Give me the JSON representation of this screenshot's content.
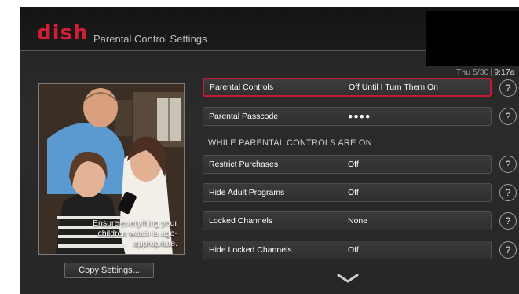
{
  "header": {
    "brand": "dish",
    "title": "Parental Control Settings"
  },
  "status": {
    "date": "Thu 5/30",
    "separator": "|",
    "time": "9:17a"
  },
  "promo": {
    "caption": "Ensure everything your children watch is age-appropriate."
  },
  "copy_button": "Copy Settings...",
  "settings": [
    {
      "label": "Parental Controls",
      "value": "Off Until I Turn Them On",
      "selected": true
    },
    {
      "label": "Parental Passcode",
      "value": "●●●●"
    }
  ],
  "section_heading": "WHILE PARENTAL CONTROLS ARE ON",
  "restrictions": [
    {
      "label": "Restrict Purchases",
      "value": "Off"
    },
    {
      "label": "Hide Adult Programs",
      "value": "Off"
    },
    {
      "label": "Locked Channels",
      "value": "None"
    },
    {
      "label": "Hide Locked Channels",
      "value": "Off"
    }
  ],
  "help_label": "?",
  "colors": {
    "brand_red": "#d11f36",
    "selection_border": "#c81a34",
    "background": "#262626"
  },
  "icons": {
    "help": "question-circle-icon",
    "more": "chevron-down-icon"
  }
}
